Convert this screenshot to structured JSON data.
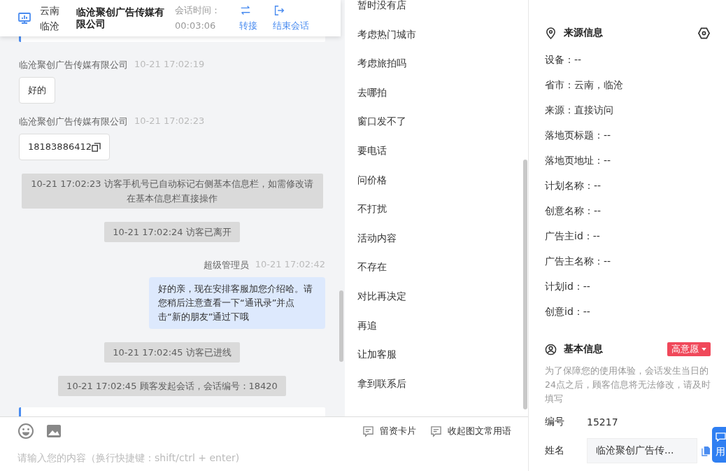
{
  "header": {
    "location": [
      "云南",
      "临沧"
    ],
    "company": "临沧聚创广告传媒有限公司",
    "timer_label": "会话时间：",
    "timer": "00:03:06",
    "actions": [
      {
        "kind": "transfer",
        "label": "转接"
      },
      {
        "kind": "end",
        "label": "结束会话"
      }
    ]
  },
  "messages": [
    {
      "kind": "card"
    },
    {
      "kind": "visitor",
      "sender": "临沧聚创广告传媒有限公司",
      "time": "10-21 17:02:19",
      "text": "好的",
      "copyable": false
    },
    {
      "kind": "visitor",
      "sender": "临沧聚创广告传媒有限公司",
      "time": "10-21 17:02:23",
      "text": "18183886412",
      "copyable": true
    },
    {
      "kind": "system",
      "text": "10-21 17:02:23 访客手机号已自动标记右侧基本信息栏，如需修改请在基本信息栏直接操作"
    },
    {
      "kind": "system",
      "text": "10-21 17:02:24 访客已离开"
    },
    {
      "kind": "agent",
      "sender": "超级管理员",
      "time": "10-21 17:02:42",
      "text": "好的亲，现在安排客服加您介绍哈。请您稍后注意查看一下“通讯录”并点击“新的朋友”通过下哦"
    },
    {
      "kind": "system",
      "text": "10-21 17:02:45 访客已进线"
    },
    {
      "kind": "system",
      "text": "10-21 17:02:45 顾客发起会话，会话编号：18420"
    },
    {
      "kind": "card"
    }
  ],
  "phrases": [
    "暂时没有店",
    "考虑热门城市",
    "考虑旅拍吗",
    "去哪拍",
    "窗口发不了",
    "要电话",
    "问价格",
    "不打扰",
    "活动内容",
    "不存在",
    "对比再决定",
    "再追",
    "让加客服",
    "拿到联系后"
  ],
  "composer": {
    "tools": [
      {
        "kind": "emoji"
      },
      {
        "kind": "image"
      }
    ],
    "actions": [
      "留资卡片",
      "收起图文常用语"
    ],
    "placeholder": "请输入您的内容（换行快捷键：shift/ctrl + enter)"
  },
  "source_info": {
    "title": "来源信息",
    "rows": [
      "设备：--",
      "省市：云南，临沧",
      "来源：直接访问",
      "落地页标题：--",
      "落地页地址：--",
      "计划名称：--",
      "创意名称：--",
      "广告主id：--",
      "广告主名称：--",
      "计划id：--",
      "创意id：--"
    ]
  },
  "basic_info": {
    "title": "基本信息",
    "intent": "高意愿",
    "notice": "为了保障您的使用体验，会话发生当日的24点之后，顾客信息将无法修改，请及时填写",
    "fields": [
      {
        "kind": "text",
        "label": "编号",
        "value": "15217"
      },
      {
        "kind": "input",
        "label": "姓名",
        "value": "临沧聚创广告传..."
      }
    ]
  },
  "side_tab": "用"
}
